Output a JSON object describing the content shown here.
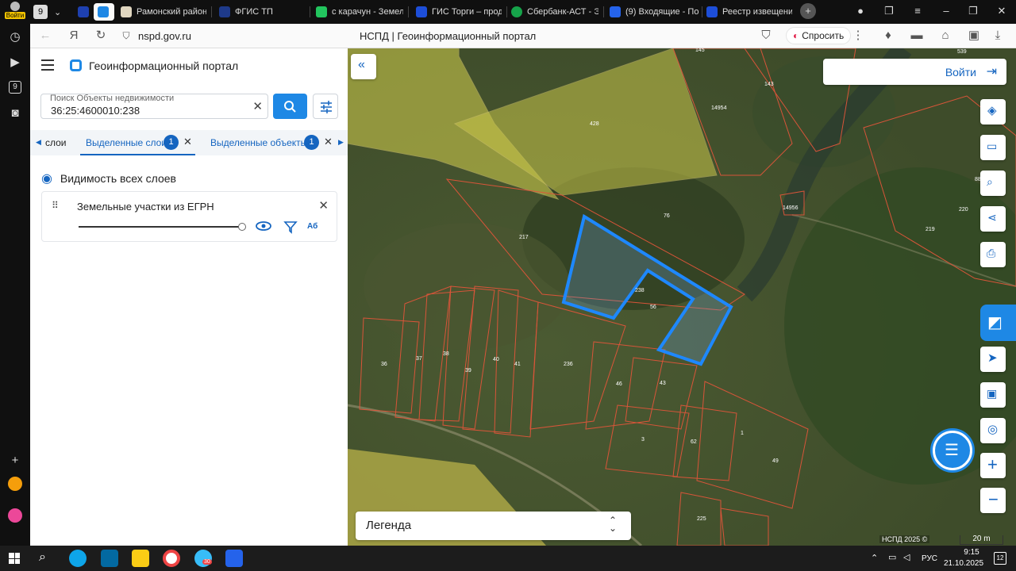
{
  "browser": {
    "tabs": [
      {
        "label": "Рамонский район",
        "color": "#e0d6c0"
      },
      {
        "label": "ФГИС ТП",
        "color": "#1e3a8a"
      },
      {
        "label": "с карачун - Земел",
        "color": "#22c55e"
      },
      {
        "label": "ГИС Торги – прод",
        "color": "#1d4ed8"
      },
      {
        "label": "Сбербанк-АСТ - Э",
        "color": "#16a34a"
      },
      {
        "label": "(9) Входящие - По",
        "color": "#2563eb"
      },
      {
        "label": "Реестр извещени",
        "color": "#1d4ed8"
      }
    ],
    "tab_count_badge": "9",
    "url": "nspd.gov.ru",
    "page_title": "НСПД | Геоинформационный портал",
    "ask_label": "Спросить",
    "login_badge": "Войти"
  },
  "panel": {
    "portal_title": "Геоинформационный портал",
    "search": {
      "label": "Поиск Объекты недвижимости",
      "value": "36:25:4600010:238"
    },
    "tabs": {
      "layers": "слои",
      "selected_layers": "Выделенные слои",
      "selected_layers_count": "1",
      "selected_objects": "Выделенные объекты",
      "selected_objects_count": "1"
    },
    "visibility_label": "Видимость всех слоев",
    "layer": {
      "name": "Земельные участки из ЕГРН",
      "opacity": 1.0,
      "filter_label": "Аб"
    }
  },
  "map": {
    "login_label": "Войти",
    "legend_label": "Легенда",
    "scale_label": "20 m",
    "copyright": "НСПД 2025 ©",
    "parcel_labels": [
      "145",
      "539",
      "143",
      "14954",
      "428",
      "88",
      "14956",
      "76",
      "220",
      "219",
      "217",
      "238",
      "56",
      "36",
      "37",
      "38",
      "39",
      "40",
      "41",
      "236",
      "46",
      "43",
      "3",
      "62",
      "1",
      "49",
      "225"
    ],
    "highlight_color": "#1e88ff"
  },
  "taskbar": {
    "lang": "РУС",
    "time": "9:15",
    "date": "21.10.2025",
    "notifications": "12",
    "telegram_badge": "30"
  }
}
